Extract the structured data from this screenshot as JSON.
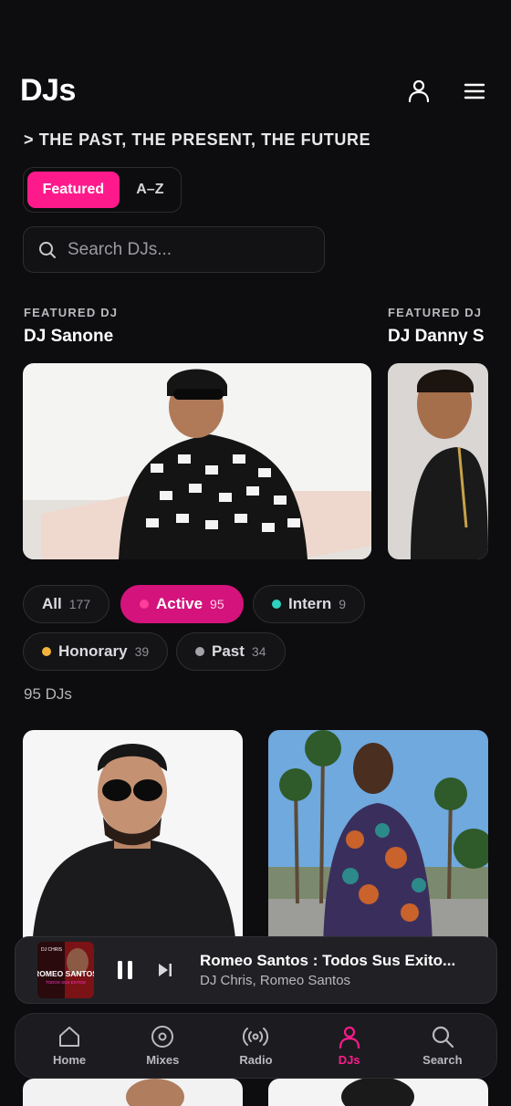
{
  "header": {
    "title": "DJs",
    "tagline": "> THE PAST, THE PRESENT, THE FUTURE"
  },
  "view_toggle": {
    "featured": "Featured",
    "az": "A–Z",
    "selected": "Featured"
  },
  "search": {
    "placeholder": "Search DJs..."
  },
  "featured": [
    {
      "label": "FEATURED DJ",
      "name": "DJ Sanone"
    },
    {
      "label": "FEATURED DJ",
      "name": "DJ Danny S"
    }
  ],
  "filters": [
    {
      "label": "All",
      "count": "177",
      "dot": ""
    },
    {
      "label": "Active",
      "count": "95",
      "dot": "#ff3d9a"
    },
    {
      "label": "Intern",
      "count": "9",
      "dot": "#2ed3c0"
    },
    {
      "label": "Honorary",
      "count": "39",
      "dot": "#f2b33d"
    },
    {
      "label": "Past",
      "count": "34",
      "dot": "#a3a3a8"
    }
  ],
  "results": {
    "count_text": "95 DJs"
  },
  "now_playing": {
    "title": "Romeo Santos : Todos Sus Exito...",
    "artist": "DJ Chris, Romeo Santos",
    "art_top": "DJ CHRIS",
    "art_main": "ROMEO SANTOS",
    "art_sub": "TODOS SUS EXITOS"
  },
  "tabs": [
    {
      "label": "Home",
      "icon": "home-icon"
    },
    {
      "label": "Mixes",
      "icon": "mixes-icon"
    },
    {
      "label": "Radio",
      "icon": "radio-icon"
    },
    {
      "label": "DJs",
      "icon": "dj-icon"
    },
    {
      "label": "Search",
      "icon": "search-icon"
    }
  ],
  "active_tab": "DJs",
  "colors": {
    "accent": "#ff1a8c",
    "background": "#0d0d0f"
  }
}
